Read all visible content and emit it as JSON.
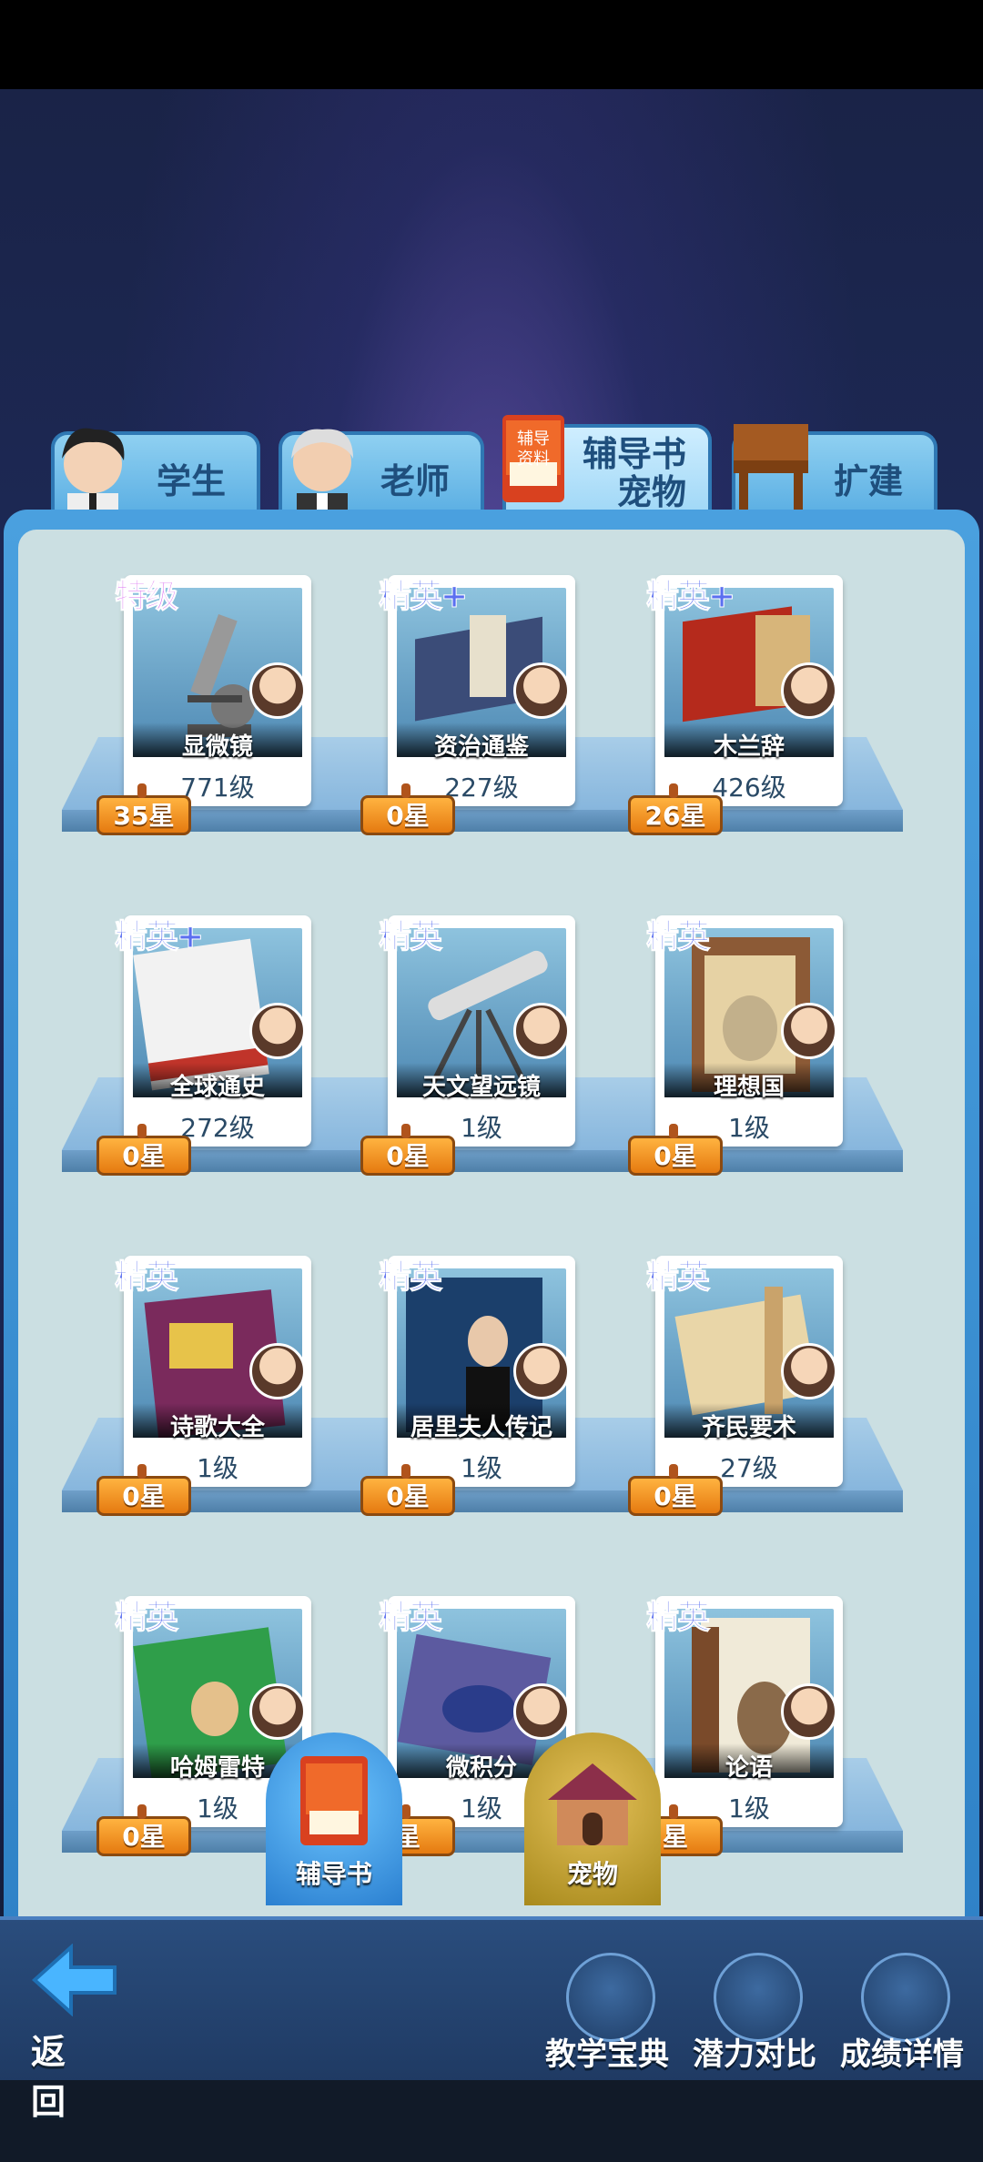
{
  "tabs": [
    {
      "label": "学生"
    },
    {
      "label": "老师"
    },
    {
      "label_line1": "辅导书",
      "label_line2": "宠物"
    },
    {
      "label": "扩建"
    }
  ],
  "items": [
    {
      "grade": "特级",
      "name": "显微镜",
      "level": "771级",
      "stars": "35星"
    },
    {
      "grade": "精英+",
      "name": "资治通鉴",
      "level": "227级",
      "stars": "0星"
    },
    {
      "grade": "精英+",
      "name": "木兰辞",
      "level": "426级",
      "stars": "26星"
    },
    {
      "grade": "精英+",
      "name": "全球通史",
      "level": "272级",
      "stars": "0星"
    },
    {
      "grade": "精英",
      "name": "天文望远镜",
      "level": "1级",
      "stars": "0星"
    },
    {
      "grade": "精英",
      "name": "理想国",
      "level": "1级",
      "stars": "0星"
    },
    {
      "grade": "精英",
      "name": "诗歌大全",
      "level": "1级",
      "stars": "0星"
    },
    {
      "grade": "精英",
      "name": "居里夫人传记",
      "level": "1级",
      "stars": "0星"
    },
    {
      "grade": "精英",
      "name": "齐民要术",
      "level": "27级",
      "stars": "0星"
    },
    {
      "grade": "精英",
      "name": "哈姆雷特",
      "level": "1级",
      "stars": "0星"
    },
    {
      "grade": "精英",
      "name": "微积分",
      "level": "1级",
      "stars": "星"
    },
    {
      "grade": "精英",
      "name": "论语",
      "level": "1级",
      "stars": "星"
    }
  ],
  "float_buttons": {
    "books": "辅导书",
    "pets": "宠物"
  },
  "bottom": {
    "back": "返 回",
    "tools": [
      "教学宝典",
      "潜力对比",
      "成绩详情"
    ]
  },
  "colors": {
    "accent": "#2f82c7",
    "star_tag": "#f39a20",
    "elite": "#5b6ff0",
    "special": "#d96cf0"
  }
}
